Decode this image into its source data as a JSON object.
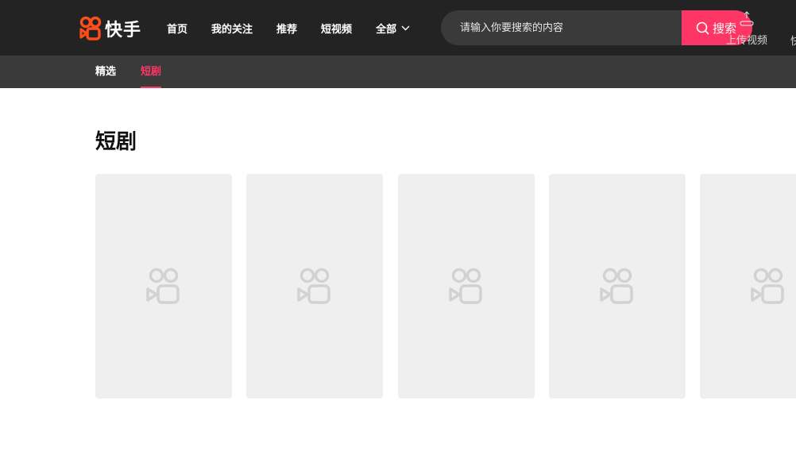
{
  "brand": {
    "name": "快手",
    "logo_color": "#fe4e1c"
  },
  "nav": {
    "items": [
      {
        "label": "首页"
      },
      {
        "label": "我的关注"
      },
      {
        "label": "推荐"
      },
      {
        "label": "短视频"
      },
      {
        "label": "全部"
      }
    ]
  },
  "search": {
    "placeholder": "请输入你要搜索的内容",
    "button_label": "搜索",
    "accent": "#fe3666"
  },
  "upload": {
    "label": "上传视频"
  },
  "edge": {
    "text": "快"
  },
  "subnav": {
    "tabs": [
      {
        "label": "精选"
      },
      {
        "label": "短剧",
        "active": true
      }
    ]
  },
  "section": {
    "title": "短剧"
  },
  "cards": {
    "count": 5,
    "placeholder_icon": "camera-logo-icon"
  }
}
